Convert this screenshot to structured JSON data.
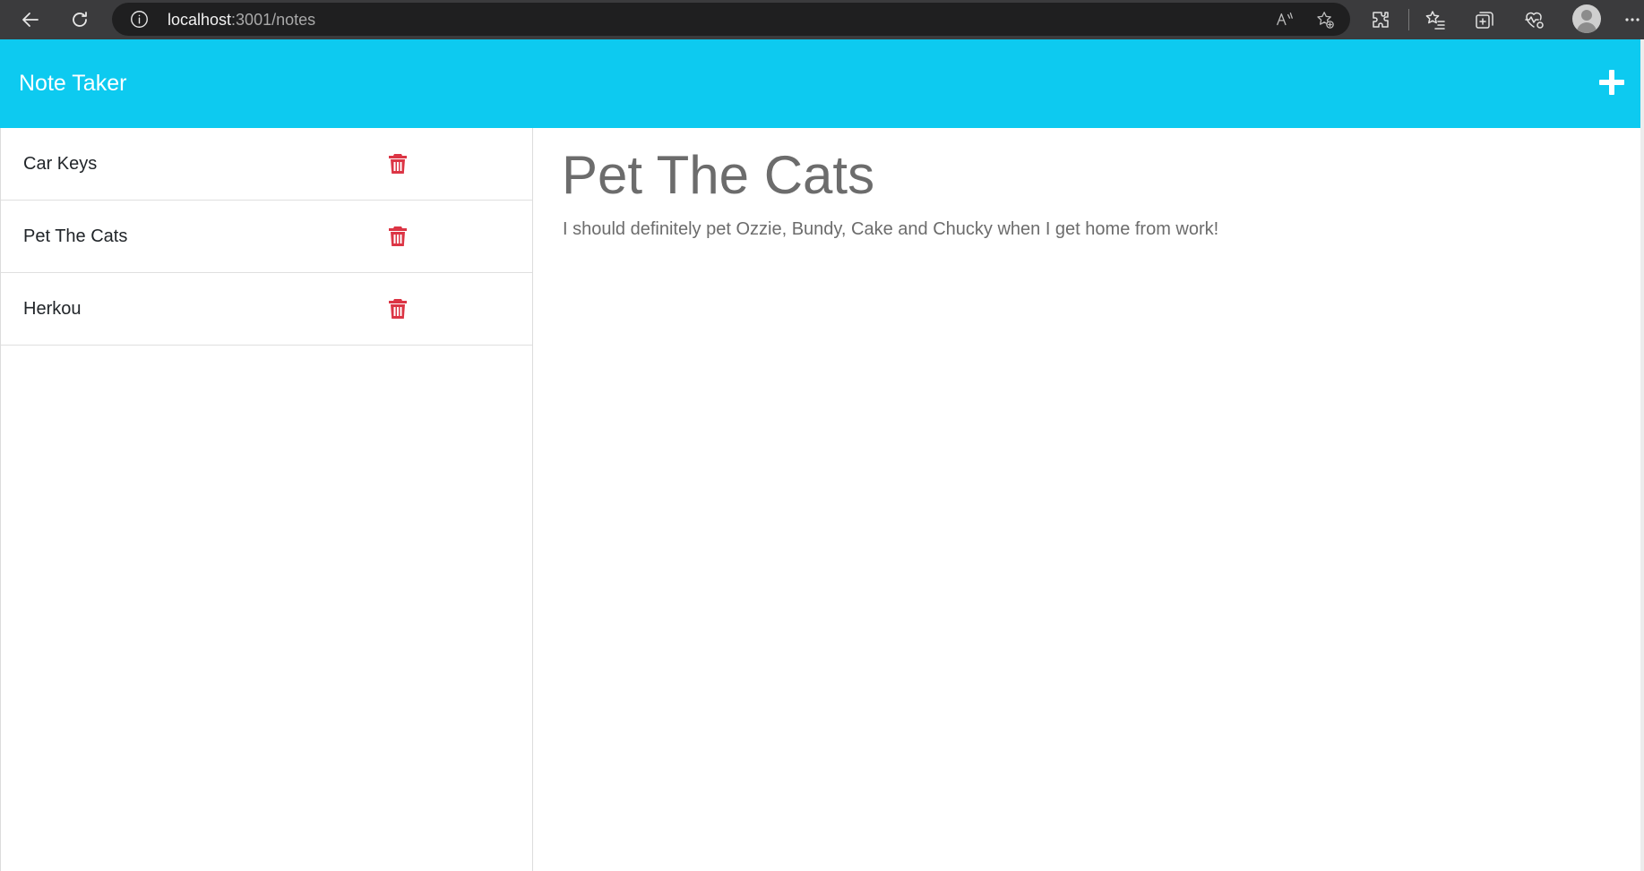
{
  "browser": {
    "url_host": "localhost",
    "url_path": ":3001/notes"
  },
  "app": {
    "title": "Note Taker",
    "accent_color": "#0dcaf0",
    "delete_color": "#dc3545"
  },
  "notes": [
    {
      "title": "Car Keys"
    },
    {
      "title": "Pet The Cats"
    },
    {
      "title": "Herkou"
    }
  ],
  "active_note": {
    "title": "Pet The Cats",
    "text": "I should definitely pet Ozzie, Bundy, Cake and Chucky when I get home from work!"
  },
  "icons": {
    "back": "arrow-left-icon",
    "refresh": "refresh-icon",
    "info": "info-icon",
    "read_aloud": "read-aloud-icon",
    "add_favorite": "star-plus-icon",
    "extensions": "puzzle-icon",
    "favorites": "star-list-icon",
    "collections": "collections-icon",
    "health": "heart-pulse-icon",
    "profile": "profile-avatar-icon",
    "more": "ellipsis-icon",
    "new_note": "plus-icon",
    "delete": "trash-icon"
  }
}
